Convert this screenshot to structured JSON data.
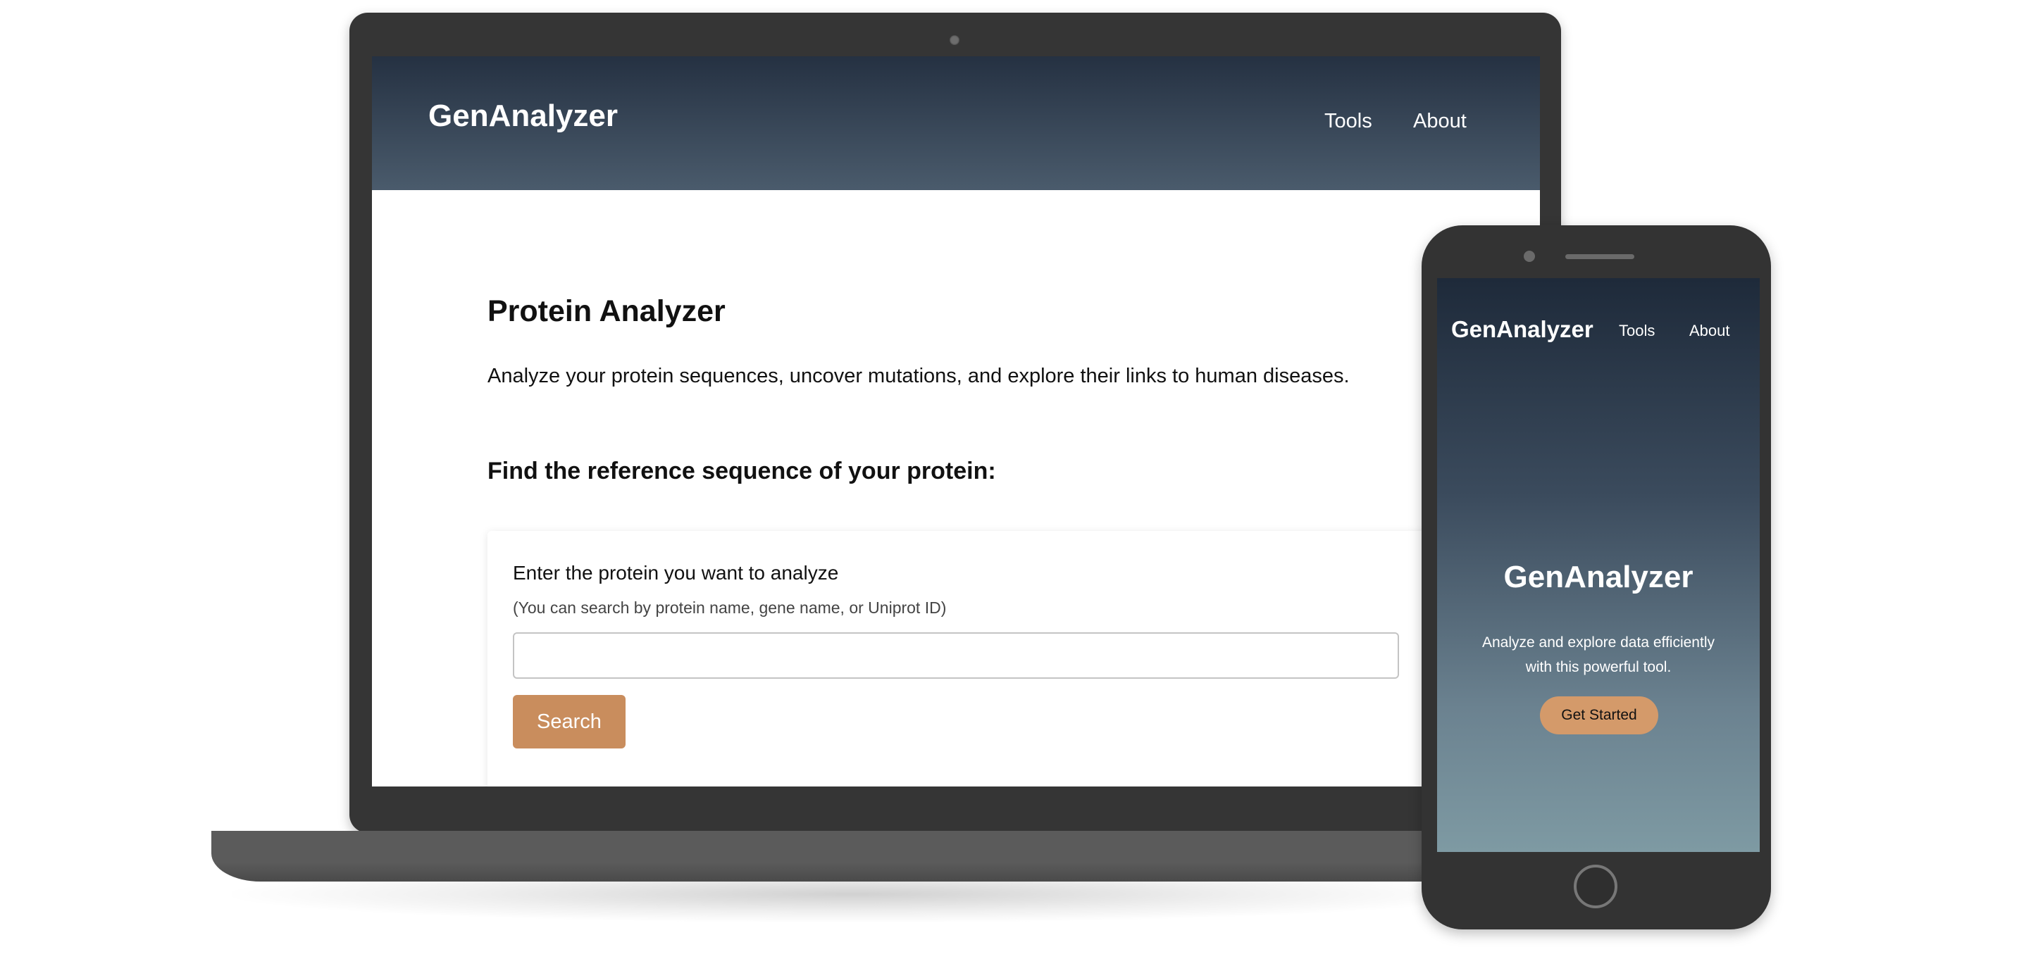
{
  "laptop": {
    "header": {
      "logo": "GenAnalyzer",
      "nav": [
        "Tools",
        "About"
      ]
    },
    "main": {
      "title": "Protein Analyzer",
      "description": "Analyze your protein sequences, uncover mutations, and explore their links to human diseases.",
      "subtitle": "Find the reference sequence of your protein:",
      "search_card": {
        "label": "Enter the protein you want to analyze",
        "hint": "(You can search by protein name, gene name, or Uniprot ID)",
        "input_value": "",
        "button_label": "Search"
      }
    }
  },
  "phone": {
    "header": {
      "logo": "GenAnalyzer",
      "nav": [
        "Tools",
        "About"
      ]
    },
    "hero": {
      "title": "GenAnalyzer",
      "text": "Analyze and explore data efficiently with this powerful tool.",
      "cta_label": "Get Started"
    }
  },
  "colors": {
    "header_gradient_top": "#253142",
    "header_gradient_bottom": "#4a5b6c",
    "search_button": "#c98d5d",
    "cta_button": "#d49a6a",
    "device_frame": "#353535"
  }
}
